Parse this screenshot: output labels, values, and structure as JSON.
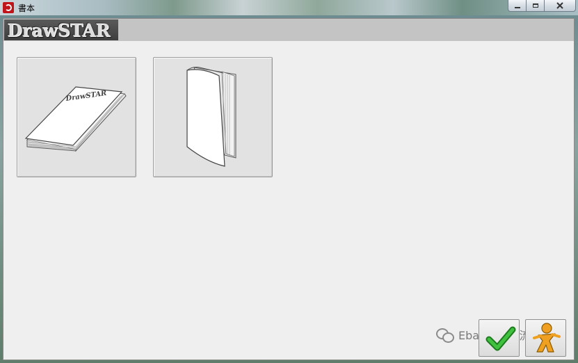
{
  "window": {
    "title": "書本",
    "icon": "app-logo-icon"
  },
  "header": {
    "logo_text": "DrawSTAR"
  },
  "tiles": [
    {
      "name": "book-flat",
      "icon": "book-flat-icon",
      "cover_text": "DrawSTAR"
    },
    {
      "name": "book-standing",
      "icon": "book-standing-icon"
    }
  ],
  "watermark": {
    "icon": "wechat-icon",
    "text": "Ebay卖家交流"
  },
  "actions": {
    "ok_icon": "checkmark-icon",
    "user_icon": "user-figure-icon"
  },
  "colors": {
    "frame_bg": "#efefef",
    "header_band": "#c4c4c4",
    "logo_bg": "#3e3e3e",
    "check_green": "#2e9e2e",
    "user_orange": "#f0a020"
  }
}
